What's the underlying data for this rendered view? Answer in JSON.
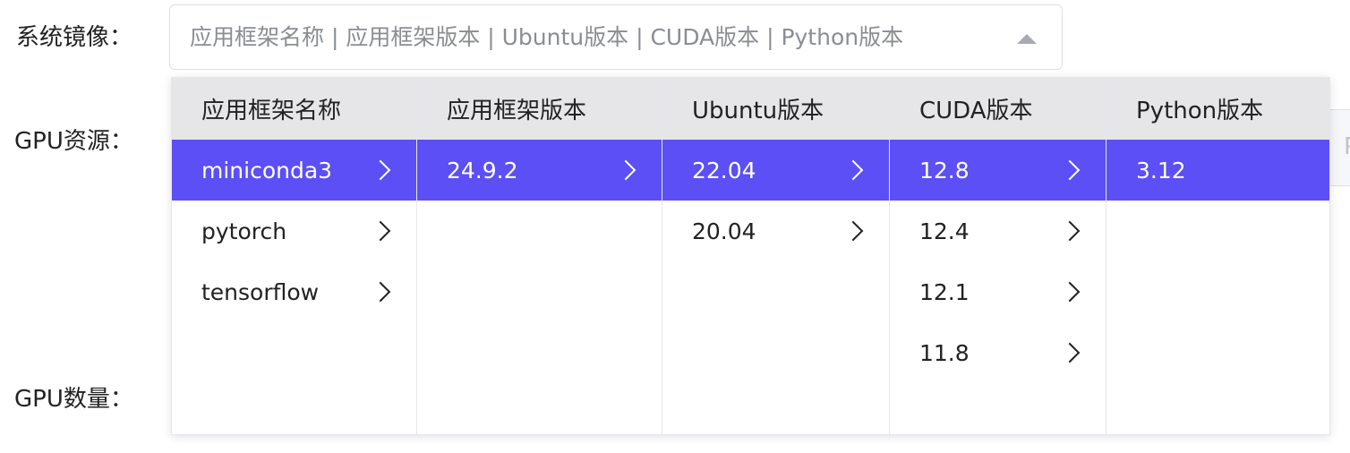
{
  "form": {
    "image_label": "系统镜像：",
    "gpu_resource_label": "GPU资源：",
    "gpu_count_label": "GPU数量："
  },
  "select": {
    "placeholder": "应用框架名称 | 应用框架版本 | Ubuntu版本 | CUDA版本 | Python版本",
    "arrow_icon": "caret-up-icon"
  },
  "gpu_resource_peek": {
    "text": "P"
  },
  "colors": {
    "selected_bg": "#5b4ff5",
    "header_bg": "#e6e6e8"
  },
  "cascader": {
    "columns": [
      {
        "header": "应用框架名称",
        "items": [
          {
            "label": "miniconda3",
            "selected": true,
            "has_children": true
          },
          {
            "label": "pytorch",
            "selected": false,
            "has_children": true
          },
          {
            "label": "tensorflow",
            "selected": false,
            "has_children": true
          }
        ]
      },
      {
        "header": "应用框架版本",
        "items": [
          {
            "label": "24.9.2",
            "selected": true,
            "has_children": true
          }
        ]
      },
      {
        "header": "Ubuntu版本",
        "items": [
          {
            "label": "22.04",
            "selected": true,
            "has_children": true
          },
          {
            "label": "20.04",
            "selected": false,
            "has_children": true
          }
        ]
      },
      {
        "header": "CUDA版本",
        "items": [
          {
            "label": "12.8",
            "selected": true,
            "has_children": true
          },
          {
            "label": "12.4",
            "selected": false,
            "has_children": true
          },
          {
            "label": "12.1",
            "selected": false,
            "has_children": true
          },
          {
            "label": "11.8",
            "selected": false,
            "has_children": true
          }
        ]
      },
      {
        "header": "Python版本",
        "items": [
          {
            "label": "3.12",
            "selected": true,
            "has_children": false
          }
        ]
      }
    ]
  }
}
